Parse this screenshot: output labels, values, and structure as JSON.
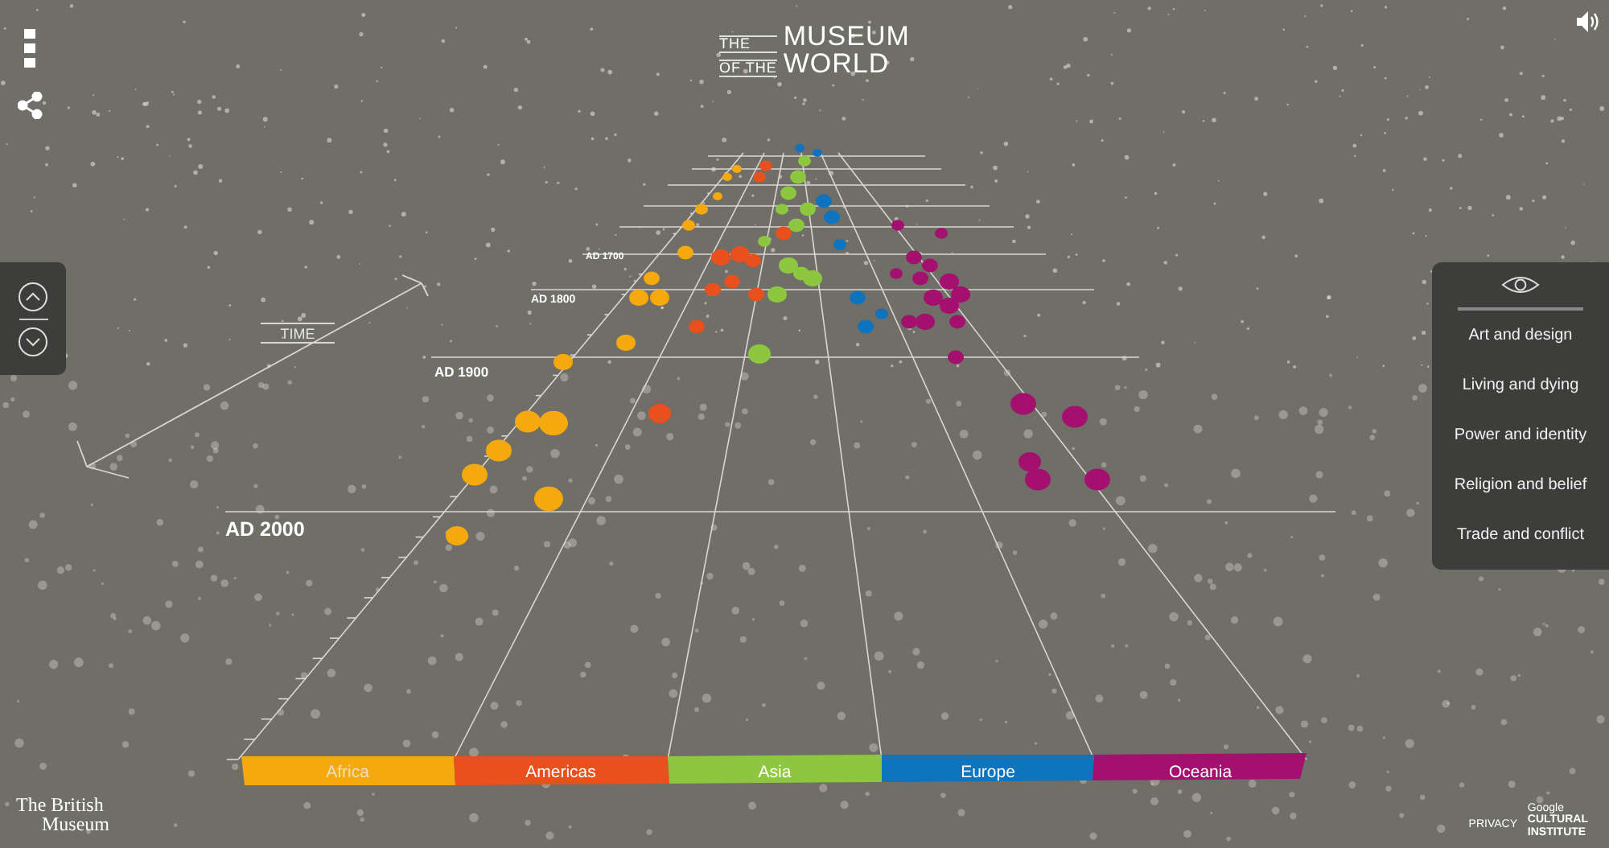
{
  "logo": [
    "THE",
    "MUSEUM",
    "OF THE",
    "WORLD"
  ],
  "axis": {
    "label": "TIME",
    "years": [
      "AD 2000",
      "AD 1900",
      "AD 1800",
      "AD 1700"
    ]
  },
  "regions": [
    {
      "label": "Africa",
      "color": "#f5a90f"
    },
    {
      "label": "Americas",
      "color": "#e8501e"
    },
    {
      "label": "Asia",
      "color": "#8dc63f"
    },
    {
      "label": "Europe",
      "color": "#0e74bf"
    },
    {
      "label": "Oceania",
      "color": "#a4106e"
    }
  ],
  "filters": [
    "Art and design",
    "Living and dying",
    "Power and identity",
    "Religion and belief",
    "Trade and conflict"
  ],
  "footer": {
    "museum": [
      "The British",
      "Museum"
    ],
    "privacy": "PRIVACY",
    "partner": [
      "Google",
      "CULTURAL",
      "INSTITUTE"
    ]
  }
}
